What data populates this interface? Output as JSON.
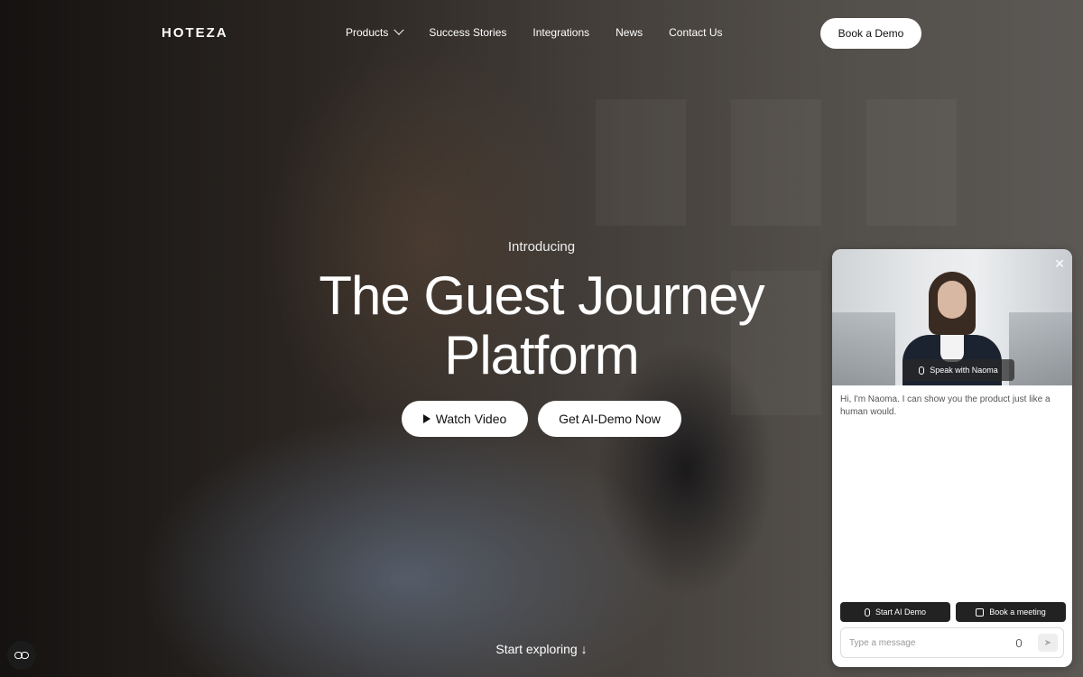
{
  "nav": {
    "logo": "HOTEZA",
    "links": [
      "Products",
      "Success Stories",
      "Integrations",
      "News",
      "Contact Us"
    ],
    "cta": "Book a Demo"
  },
  "hero": {
    "eyebrow": "Introducing",
    "headline": "The Guest Journey Platform",
    "watch_label": "Watch Video",
    "demo_label": "Get AI-Demo Now",
    "explore_label": "Start exploring ↓"
  },
  "widget": {
    "speak_label": "Speak with Naoma",
    "greeting": "Hi, I'm Naoma. I can show you the product just like a human would.",
    "start_demo_label": "Start AI Demo",
    "book_meeting_label": "Book a meeting",
    "input_placeholder": "Type a message",
    "close_icon": "close-icon",
    "send_icon": "send-icon"
  }
}
